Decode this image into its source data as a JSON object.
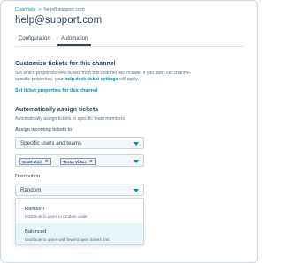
{
  "breadcrumb": {
    "parent": "Channels",
    "separator": ">",
    "current": "help@support.com"
  },
  "page_title": "help@support.com",
  "tabs": [
    {
      "label": "Configuration",
      "active": false
    },
    {
      "label": "Automation",
      "active": true
    }
  ],
  "customize": {
    "heading": "Customize tickets for this channel",
    "desc_1": "Set which properties new tickets from this channel will include.  If you don't set channel-",
    "desc_2_pre": "specific properties, your ",
    "desc_2_link": "help desk ticket settings",
    "desc_2_post": " will apply.",
    "link": "Set ticket properties for this channel"
  },
  "assign": {
    "heading": "Automatically assign tickets",
    "desc": "Automatically assign tickets to specific team members.",
    "field_label": "Assign incoming tickets to",
    "select_value": "Specific users and teams",
    "chips": [
      "Scott Moir",
      "Tessa Virtue"
    ],
    "chip_remove": "✕"
  },
  "distribution": {
    "label": "Distribution",
    "select_value": "Random",
    "options": [
      {
        "name": "Random",
        "desc": "Distribute to users in random order"
      },
      {
        "name": "Balanced",
        "desc": "Distribute to users with fewest open tickets first",
        "hovered": true
      }
    ]
  },
  "colors": {
    "accent": "#0091ae",
    "text": "#33475b",
    "muted": "#516f90",
    "hover": "#e5f5f8"
  }
}
